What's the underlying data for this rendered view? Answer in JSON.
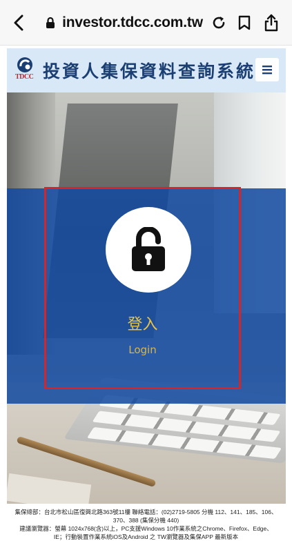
{
  "browser": {
    "url": "investor.tdcc.com.tw",
    "icons": {
      "back": "chevron-left-icon",
      "secure": "lock-icon",
      "reload": "reload-icon",
      "bookmarks": "book-icon",
      "share": "share-icon"
    }
  },
  "header": {
    "logo_text": "TDCC",
    "title": "投資人集保資料查詢系統",
    "menu_icon": "menu-icon"
  },
  "login": {
    "label_zh": "登入",
    "label_en": "Login",
    "icon": "unlocked-padlock-icon"
  },
  "footer": {
    "line1": "集保總部：台北市松山區復興北路363號11樓 聯絡電話：(02)2719-5805 分機 112、141、185、106、",
    "line2": "370、388 (集保分機 440)",
    "line3": "建議瀏覽器：螢幕 1024x768(含)以上，PC支援Windows 10作業系統之Chrome、Firefox、Edge、",
    "line4": "IE；行動裝置作業系統iOS及Android 之 TW瀏覽器及集保APP 最新版本"
  },
  "colors": {
    "panel_blue": "#1249a0",
    "highlight_red": "#d3252a",
    "login_text": "#e8c44a",
    "header_bg": "#d9e8f6",
    "title_blue": "#1b3f73"
  }
}
